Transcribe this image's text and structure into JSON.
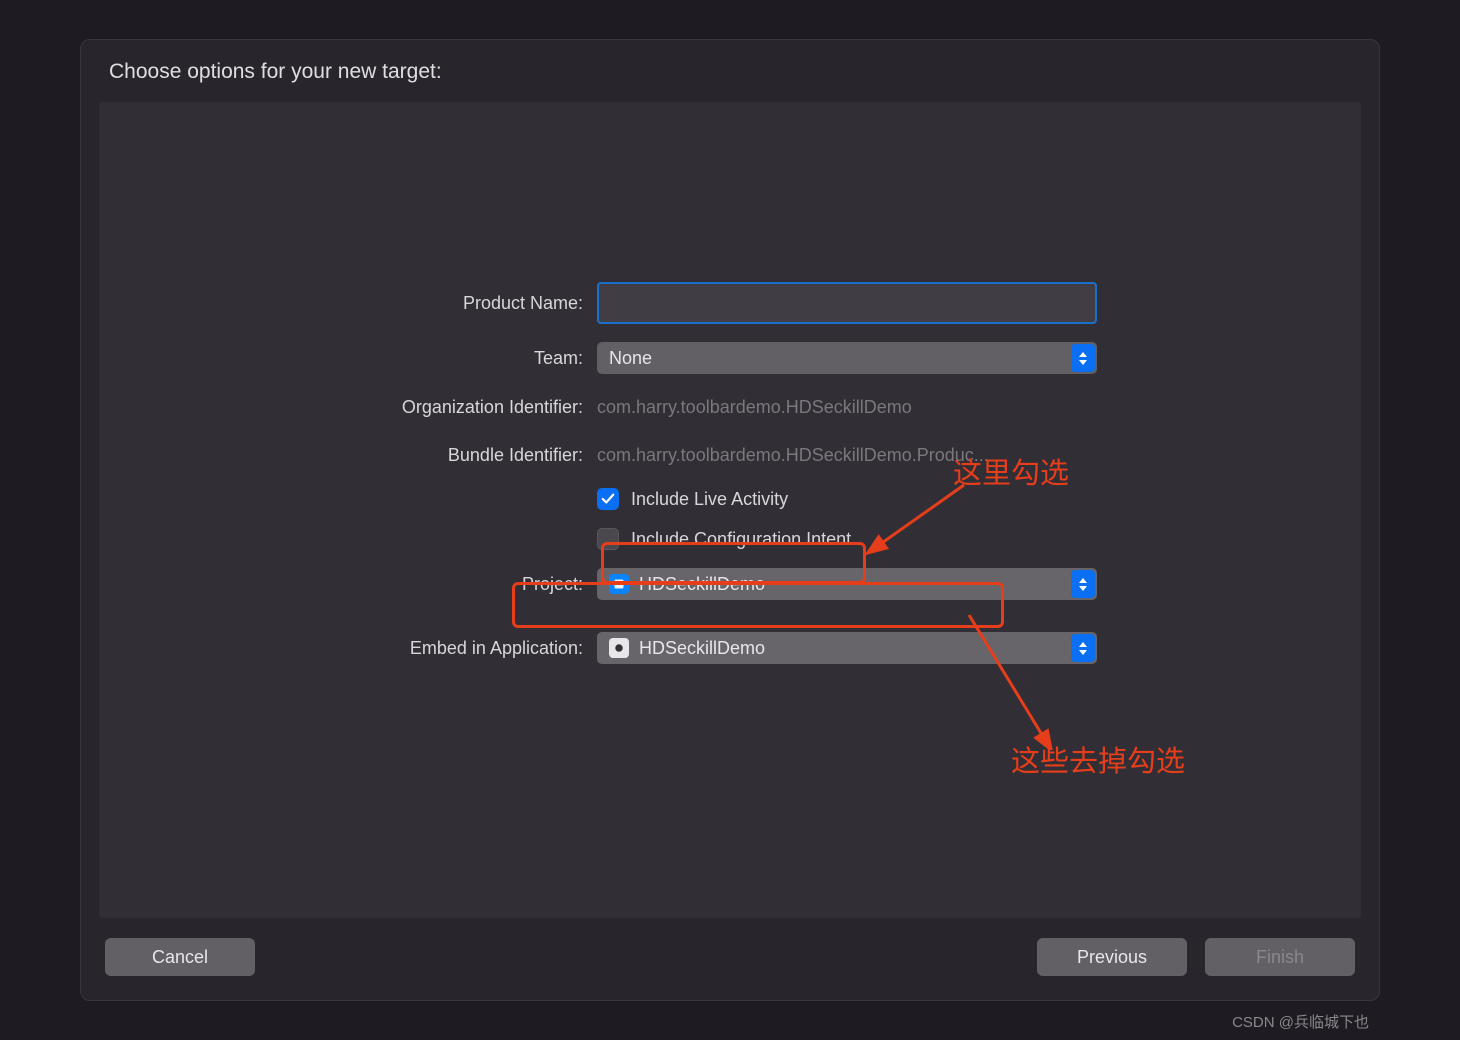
{
  "dialog": {
    "title": "Choose options for your new target:"
  },
  "form": {
    "product_name": {
      "label": "Product Name:",
      "value": ""
    },
    "team": {
      "label": "Team:",
      "value": "None"
    },
    "org_id": {
      "label": "Organization Identifier:",
      "value": "com.harry.toolbardemo.HDSeckillDemo"
    },
    "bundle_id": {
      "label": "Bundle Identifier:",
      "value": "com.harry.toolbardemo.HDSeckillDemo.Produc..."
    },
    "live_activity": {
      "label": "Include Live Activity",
      "checked": true
    },
    "config_intent": {
      "label": "Include Configuration Intent",
      "checked": false
    },
    "project": {
      "label": "Project:",
      "value": "HDSeckillDemo"
    },
    "embed": {
      "label": "Embed in Application:",
      "value": "HDSeckillDemo"
    }
  },
  "annotations": {
    "check_this": "这里勾选",
    "uncheck_these": "这些去掉勾选"
  },
  "buttons": {
    "cancel": "Cancel",
    "previous": "Previous",
    "finish": "Finish"
  },
  "watermark": "CSDN @兵临城下也"
}
